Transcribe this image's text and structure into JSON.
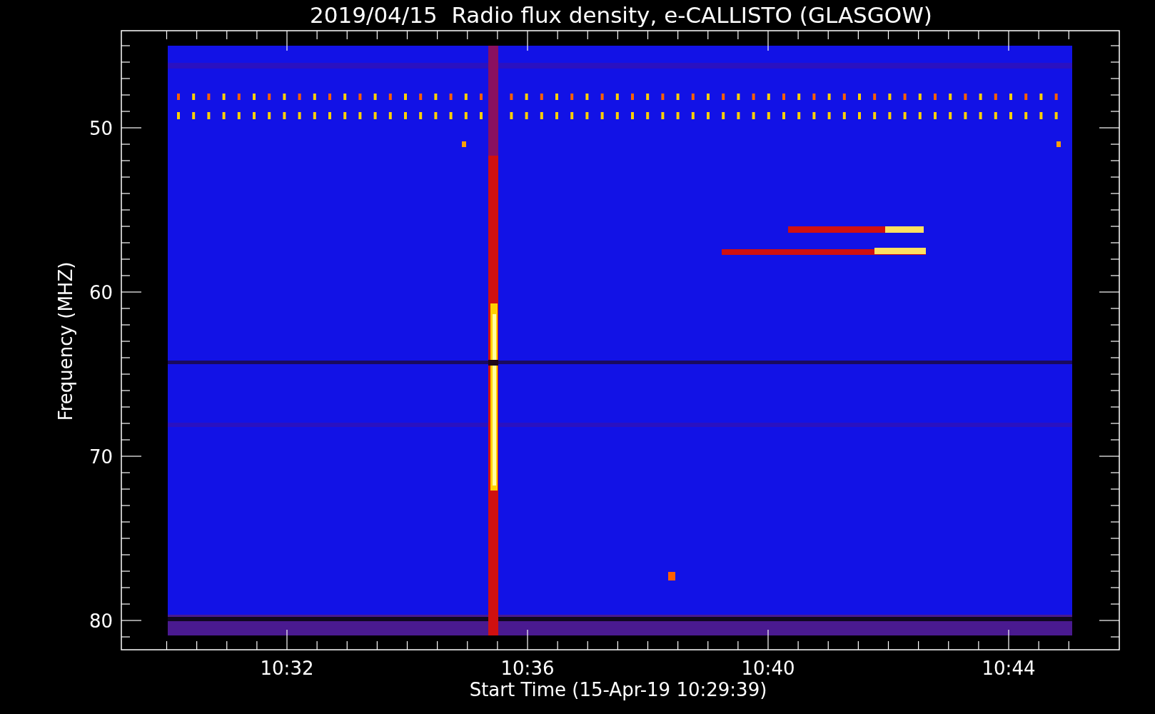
{
  "title": "2019/04/15  Radio flux density, e-CALLISTO (GLASGOW)",
  "y_axis": {
    "label": "Frequency (MHZ)",
    "ticks": [
      "50",
      "60",
      "70",
      "80"
    ]
  },
  "x_axis": {
    "label": "Start Time (15-Apr-19 10:29:39)",
    "ticks": [
      "10:32",
      "10:36",
      "10:40",
      "10:44"
    ]
  }
}
